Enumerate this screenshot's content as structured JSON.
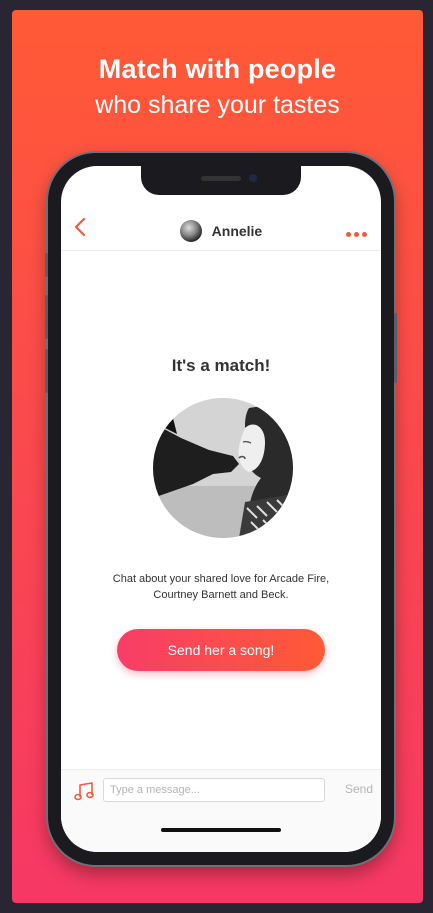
{
  "promo": {
    "headline_line1": "Match with people",
    "headline_line2": "who share your tastes"
  },
  "chat": {
    "back_icon": "chevron-left-icon",
    "user_name": "Annelie",
    "more_icon": "more-dots-icon",
    "match_title": "It's a match!",
    "description": "Chat about your shared love for Arcade Fire, Courtney Barnett and Beck.",
    "cta_label": "Send her a song!",
    "music_icon": "music-note-icon",
    "message_placeholder": "Type a message...",
    "message_value": "",
    "send_label": "Send"
  },
  "colors": {
    "accent": "#f25a3c",
    "gradient_top": "#ff5a36",
    "gradient_bottom": "#f63864"
  }
}
